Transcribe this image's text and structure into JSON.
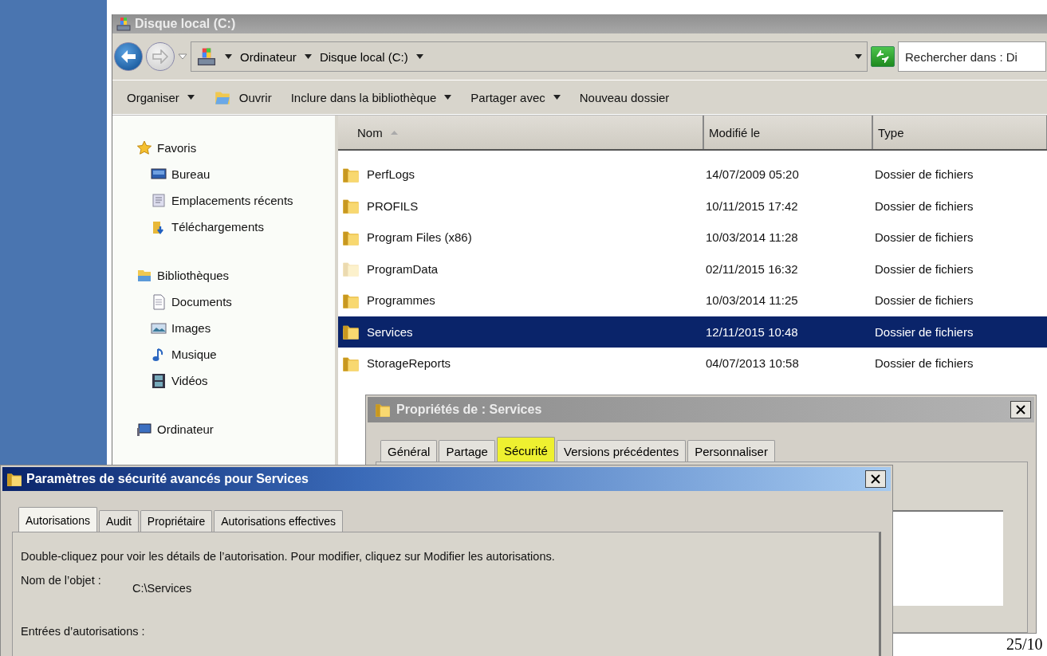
{
  "explorer": {
    "title": "Disque local (C:)",
    "active": false,
    "breadcrumb": [
      "Ordinateur",
      "Disque local (C:)"
    ],
    "search": {
      "placeholder": "Rechercher dans : Di"
    },
    "toolbar": [
      {
        "label": "Organiser",
        "kind": "menu"
      },
      {
        "label": "Ouvrir",
        "kind": "open"
      },
      {
        "label": "Inclure dans la bibliothèque",
        "kind": "menu"
      },
      {
        "label": "Partager avec",
        "kind": "menu"
      },
      {
        "label": "Nouveau dossier",
        "kind": "plain"
      }
    ],
    "sidebar": {
      "items": [
        {
          "label": "Favoris",
          "children": [
            {
              "label": "Bureau"
            },
            {
              "label": "Emplacements récents"
            },
            {
              "label": "Téléchargements"
            }
          ]
        },
        {
          "label": "Bibliothèques",
          "children": [
            {
              "label": "Documents"
            },
            {
              "label": "Images"
            },
            {
              "label": "Musique"
            },
            {
              "label": "Vidéos"
            }
          ]
        },
        {
          "label": "Ordinateur"
        }
      ]
    },
    "table": {
      "columns": [
        {
          "label": "Nom",
          "sorted": true
        },
        {
          "label": "Modifié le",
          "sorted": false
        },
        {
          "label": "Type",
          "sorted": false
        }
      ],
      "rows": [
        {
          "name": "PerfLogs",
          "modified": "14/07/2009 05:20",
          "type": "Dossier de fichiers",
          "selected": false,
          "hidden": false
        },
        {
          "name": "PROFILS",
          "modified": "10/11/2015 17:42",
          "type": "Dossier de fichiers",
          "selected": false,
          "hidden": false
        },
        {
          "name": "Program Files (x86)",
          "modified": "10/03/2014 11:28",
          "type": "Dossier de fichiers",
          "selected": false,
          "hidden": false
        },
        {
          "name": "ProgramData",
          "modified": "02/11/2015 16:32",
          "type": "Dossier de fichiers",
          "selected": false,
          "hidden": true
        },
        {
          "name": "Programmes",
          "modified": "10/03/2014 11:25",
          "type": "Dossier de fichiers",
          "selected": false,
          "hidden": false
        },
        {
          "name": "Services",
          "modified": "12/11/2015 10:48",
          "type": "Dossier de fichiers",
          "selected": true,
          "hidden": false
        },
        {
          "name": "StorageReports",
          "modified": "04/07/2013 10:58",
          "type": "Dossier de fichiers",
          "selected": false,
          "hidden": false
        }
      ]
    }
  },
  "properties_dialog": {
    "title": "Propriétés de : Services",
    "active": false,
    "tabs": [
      {
        "label": "Général",
        "selected": false,
        "highlighted": false
      },
      {
        "label": "Partage",
        "selected": false,
        "highlighted": false
      },
      {
        "label": "Sécurité",
        "selected": true,
        "highlighted": true
      },
      {
        "label": "Versions précédentes",
        "selected": false,
        "highlighted": false
      },
      {
        "label": "Personnaliser",
        "selected": false,
        "highlighted": false
      }
    ]
  },
  "advanced_dialog": {
    "title": "Paramètres de sécurité avancés pour Services",
    "active": true,
    "tabs": [
      {
        "label": "Autorisations",
        "selected": true
      },
      {
        "label": "Audit",
        "selected": false
      },
      {
        "label": "Propriétaire",
        "selected": false
      },
      {
        "label": "Autorisations effectives",
        "selected": false
      }
    ],
    "description": "Double-cliquez pour voir les détails de l’autorisation. Pour modifier, cliquez sur Modifier les autorisations.",
    "object_name_label": "Nom de l’objet :",
    "object_name": "C:\\Services",
    "entries_label": "Entrées d’autorisations :"
  },
  "page_number": "25/10"
}
